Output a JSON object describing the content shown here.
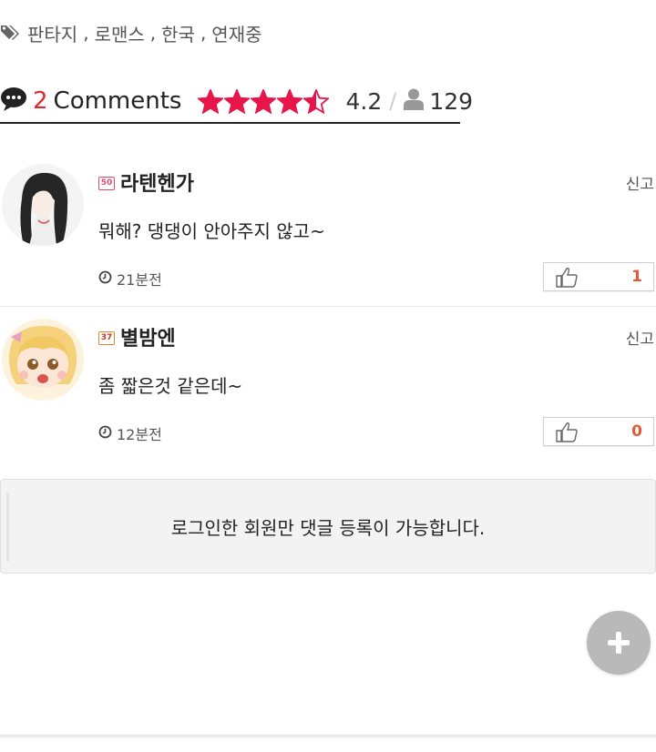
{
  "tags": {
    "items": [
      "판타지",
      "로맨스",
      "한국",
      "연재중"
    ],
    "icon": "tag-icon"
  },
  "comments_header": {
    "count": "2",
    "label": "Comments",
    "rating": "4.2",
    "rating_stars": 4.5,
    "rating_max": 5,
    "views": "129",
    "accent_color": "#e5282d",
    "star_color": "#e8154a"
  },
  "comments": [
    {
      "level": "50",
      "username": "라텐헨가",
      "report_label": "신고",
      "text": "뭐해? 댕댕이 안아주지 않고~",
      "time": "21분전",
      "likes": "1",
      "avatar": "dark-haired-girl-avatar"
    },
    {
      "level": "37",
      "username": "별밤엔",
      "report_label": "신고",
      "text": "좀 짧은것 같은데~",
      "time": "12분전",
      "likes": "0",
      "avatar": "blonde-anime-girl-avatar"
    }
  ],
  "login_notice": "로그인한 회원만 댓글 등록이 가능합니다.",
  "fab": {
    "icon": "plus-icon"
  }
}
